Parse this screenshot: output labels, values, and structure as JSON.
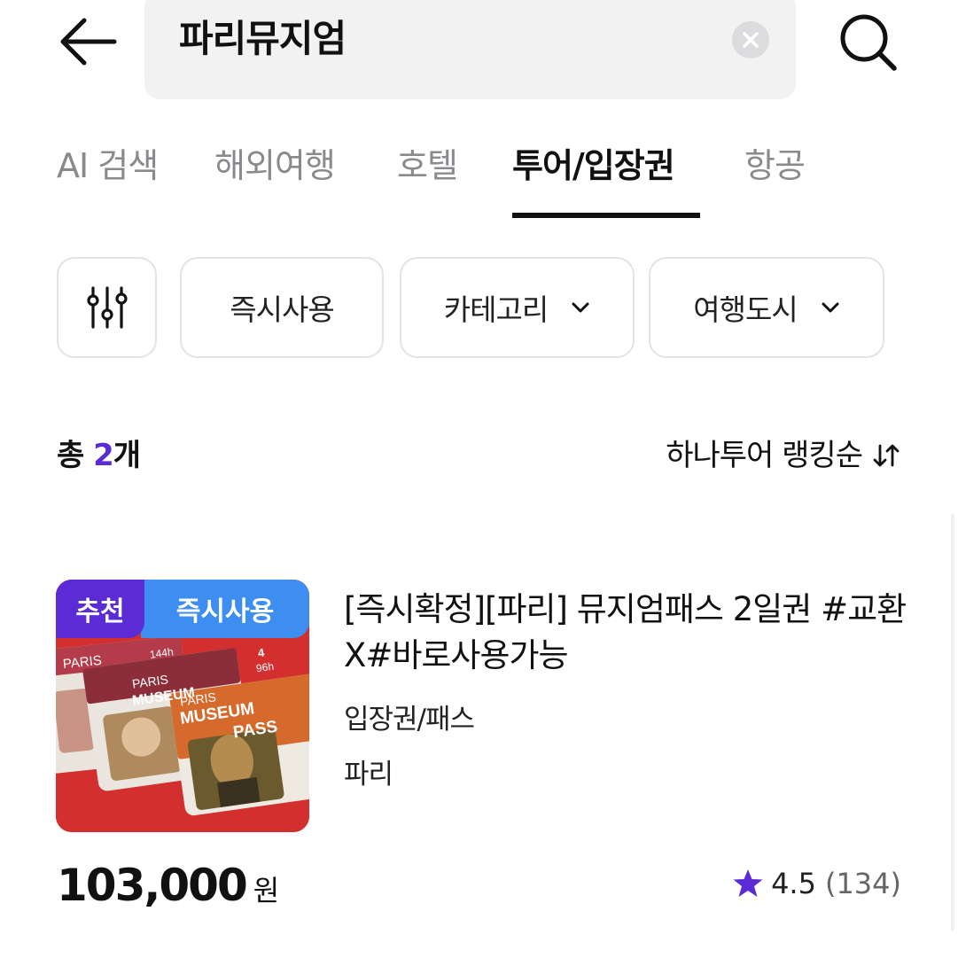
{
  "search": {
    "query": "파리뮤지엄"
  },
  "tabs": [
    {
      "label": "AI 검색",
      "active": false
    },
    {
      "label": "해외여행",
      "active": false
    },
    {
      "label": "호텔",
      "active": false
    },
    {
      "label": "투어/입장권",
      "active": true
    },
    {
      "label": "항공",
      "active": false
    }
  ],
  "filters": [
    {
      "label": "즉시사용"
    },
    {
      "label": "카테고리"
    },
    {
      "label": "여행도시"
    }
  ],
  "results": {
    "count_prefix": "총 ",
    "count_num": "2",
    "count_suffix": "개",
    "sort_label": "하나투어 랭킹순"
  },
  "product": {
    "badges": {
      "recommend": "추천",
      "instant": "즉시사용"
    },
    "title": "[즉시확정][파리] 뮤지엄패스 2일권 #교환X#바로사용가능",
    "category": "입장권/패스",
    "city": "파리",
    "price": "103,000",
    "price_unit": "원",
    "rating": "4.5",
    "review_count": "(134)",
    "image_text": {
      "paris": "PARIS",
      "museum": "MUSEUM",
      "pass": "PASS",
      "hours_1": "144h",
      "hours_2": "96h",
      "days": "4"
    }
  },
  "colors": {
    "accent_purple": "#5b2bd6",
    "instant_blue": "#3d8ef0",
    "thumb_red": "#d32f2f"
  }
}
